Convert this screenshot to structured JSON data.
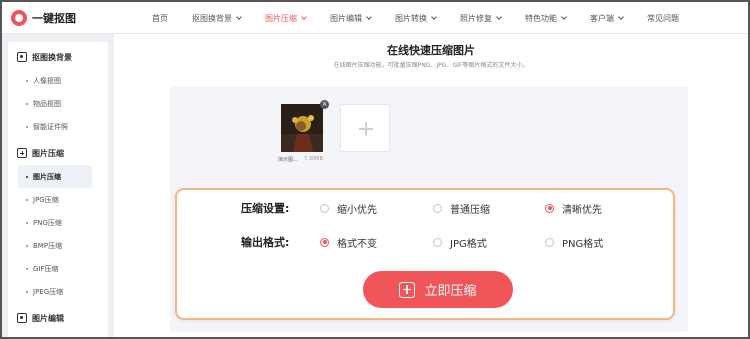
{
  "header": {
    "logo_text": "一键抠图",
    "nav": [
      {
        "label": "首页",
        "dropdown": false,
        "active": false
      },
      {
        "label": "抠图换背景",
        "dropdown": true,
        "active": false
      },
      {
        "label": "图片压缩",
        "dropdown": true,
        "active": true
      },
      {
        "label": "图片编辑",
        "dropdown": true,
        "active": false
      },
      {
        "label": "图片转换",
        "dropdown": true,
        "active": false
      },
      {
        "label": "照片修复",
        "dropdown": true,
        "active": false
      },
      {
        "label": "特色功能",
        "dropdown": true,
        "active": false
      },
      {
        "label": "客户端",
        "dropdown": true,
        "active": false
      },
      {
        "label": "常见问题",
        "dropdown": false,
        "active": false
      }
    ]
  },
  "sidebar": {
    "groups": [
      {
        "label": "抠图换背景",
        "icon": "image-cutout-icon",
        "items": [
          "人像抠图",
          "物品抠图",
          "智能证件照"
        ]
      },
      {
        "label": "图片压缩",
        "icon": "compress-icon",
        "items": [
          "图片压缩",
          "JPG压缩",
          "PNG压缩",
          "BMP压缩",
          "GIF压缩",
          "JPEG压缩"
        ],
        "active_index": 0
      },
      {
        "label": "图片编辑",
        "icon": "image-edit-icon",
        "items": []
      }
    ]
  },
  "main": {
    "title": "在线快速压缩图片",
    "subtitle": "在线图片压缩功能，可批量压缩PNG、JPG、GIF等图片格式的文件大小。",
    "file": {
      "name": "演示图...",
      "size": "7.30MB"
    }
  },
  "settings": {
    "compress_label": "压缩设置:",
    "compress_options": [
      {
        "label": "缩小优先",
        "selected": false
      },
      {
        "label": "普通压缩",
        "selected": false
      },
      {
        "label": "清晰优先",
        "selected": true
      }
    ],
    "format_label": "输出格式:",
    "format_options": [
      {
        "label": "格式不变",
        "selected": true
      },
      {
        "label": "JPG格式",
        "selected": false
      },
      {
        "label": "PNG格式",
        "selected": false
      }
    ],
    "button_label": "立即压缩"
  },
  "colors": {
    "accent": "#f0555a",
    "popup_border": "#f4b583"
  }
}
